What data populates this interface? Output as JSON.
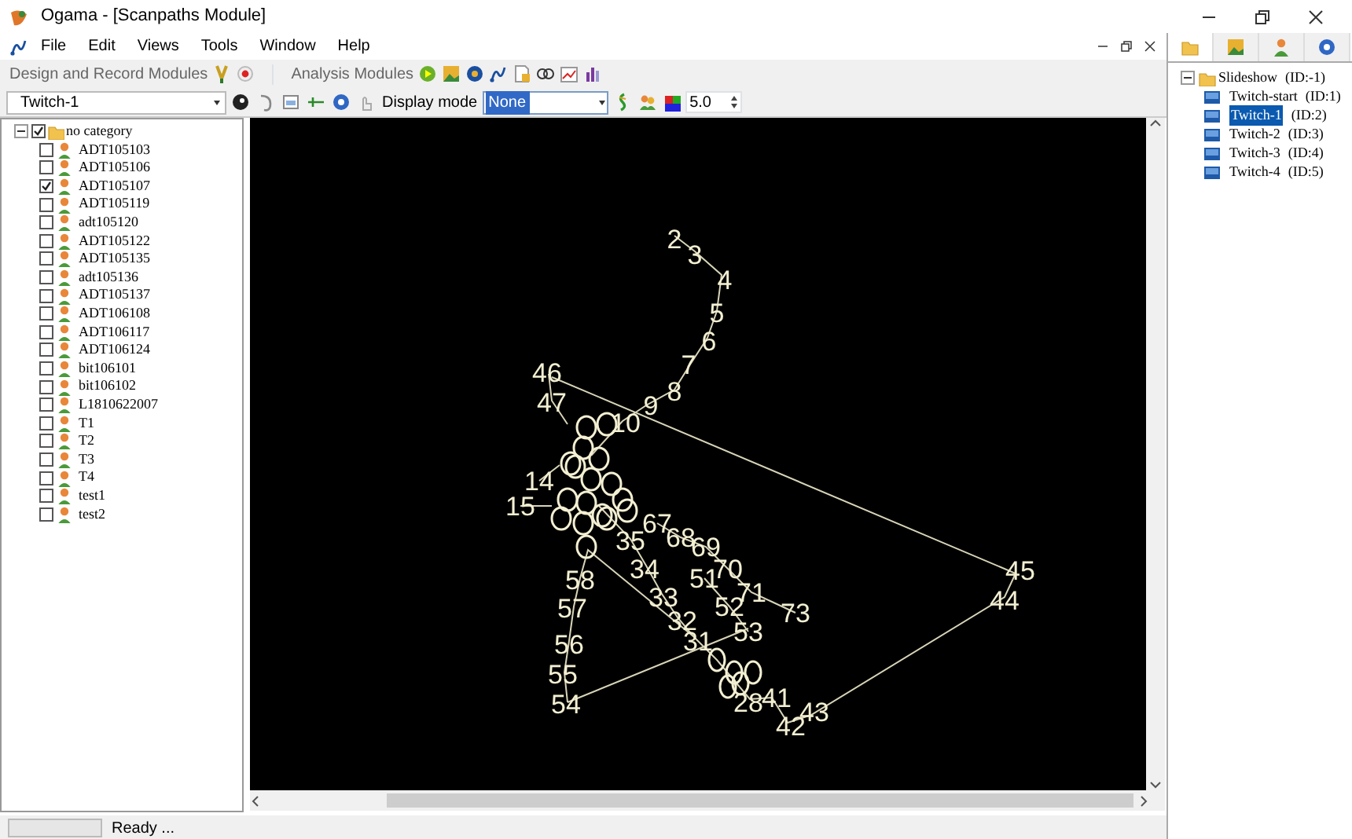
{
  "window": {
    "title": "Ogama - [Scanpaths Module]"
  },
  "menu": [
    "File",
    "Edit",
    "Views",
    "Tools",
    "Window",
    "Help"
  ],
  "modules": {
    "design_label": "Design and Record Modules",
    "analysis_label": "Analysis Modules"
  },
  "toolbar": {
    "trial": "Twitch-1",
    "display_mode_label": "Display mode",
    "display_mode": "None",
    "size": "5.0"
  },
  "subjects": {
    "root": {
      "label": "no category",
      "checked": true,
      "expanded": true
    },
    "items": [
      {
        "label": "ADT105103",
        "checked": false
      },
      {
        "label": "ADT105106",
        "checked": false
      },
      {
        "label": "ADT105107",
        "checked": true
      },
      {
        "label": "ADT105119",
        "checked": false
      },
      {
        "label": "adt105120",
        "checked": false
      },
      {
        "label": "ADT105122",
        "checked": false
      },
      {
        "label": "ADT105135",
        "checked": false
      },
      {
        "label": "adt105136",
        "checked": false
      },
      {
        "label": "ADT105137",
        "checked": false
      },
      {
        "label": "ADT106108",
        "checked": false
      },
      {
        "label": "ADT106117",
        "checked": false
      },
      {
        "label": "ADT106124",
        "checked": false
      },
      {
        "label": "bit106101",
        "checked": false
      },
      {
        "label": "bit106102",
        "checked": false
      },
      {
        "label": "L1810622007",
        "checked": false
      },
      {
        "label": "T1",
        "checked": false
      },
      {
        "label": "T2",
        "checked": false
      },
      {
        "label": "T3",
        "checked": false
      },
      {
        "label": "T4",
        "checked": false
      },
      {
        "label": "test1",
        "checked": false
      },
      {
        "label": "test2",
        "checked": false
      }
    ]
  },
  "fixations": [
    "2",
    "3",
    "4",
    "5",
    "6",
    "7",
    "8",
    "9",
    "10",
    "46",
    "47",
    "45",
    "44",
    "15",
    "14",
    "58",
    "57",
    "56",
    "55",
    "54",
    "34",
    "35",
    "33",
    "32",
    "31",
    "53",
    "52",
    "51",
    "70",
    "71",
    "73",
    "67",
    "68",
    "69",
    "28",
    "41",
    "42",
    "43"
  ],
  "slideshow": {
    "root": {
      "label": "Slideshow",
      "id": "(ID:-1)",
      "expanded": true
    },
    "items": [
      {
        "label": "Twitch-start",
        "id": "(ID:1)",
        "selected": false
      },
      {
        "label": "Twitch-1",
        "id": "(ID:2)",
        "selected": true
      },
      {
        "label": "Twitch-2",
        "id": "(ID:3)",
        "selected": false
      },
      {
        "label": "Twitch-3",
        "id": "(ID:4)",
        "selected": false
      },
      {
        "label": "Twitch-4",
        "id": "(ID:5)",
        "selected": false
      }
    ]
  },
  "right_tabs": [
    {
      "kind": "folder",
      "selected": true
    },
    {
      "kind": "slide",
      "selected": false
    },
    {
      "kind": "person",
      "selected": false
    },
    {
      "kind": "help",
      "selected": false
    }
  ],
  "status_bar": {
    "text": "Ready ..."
  }
}
